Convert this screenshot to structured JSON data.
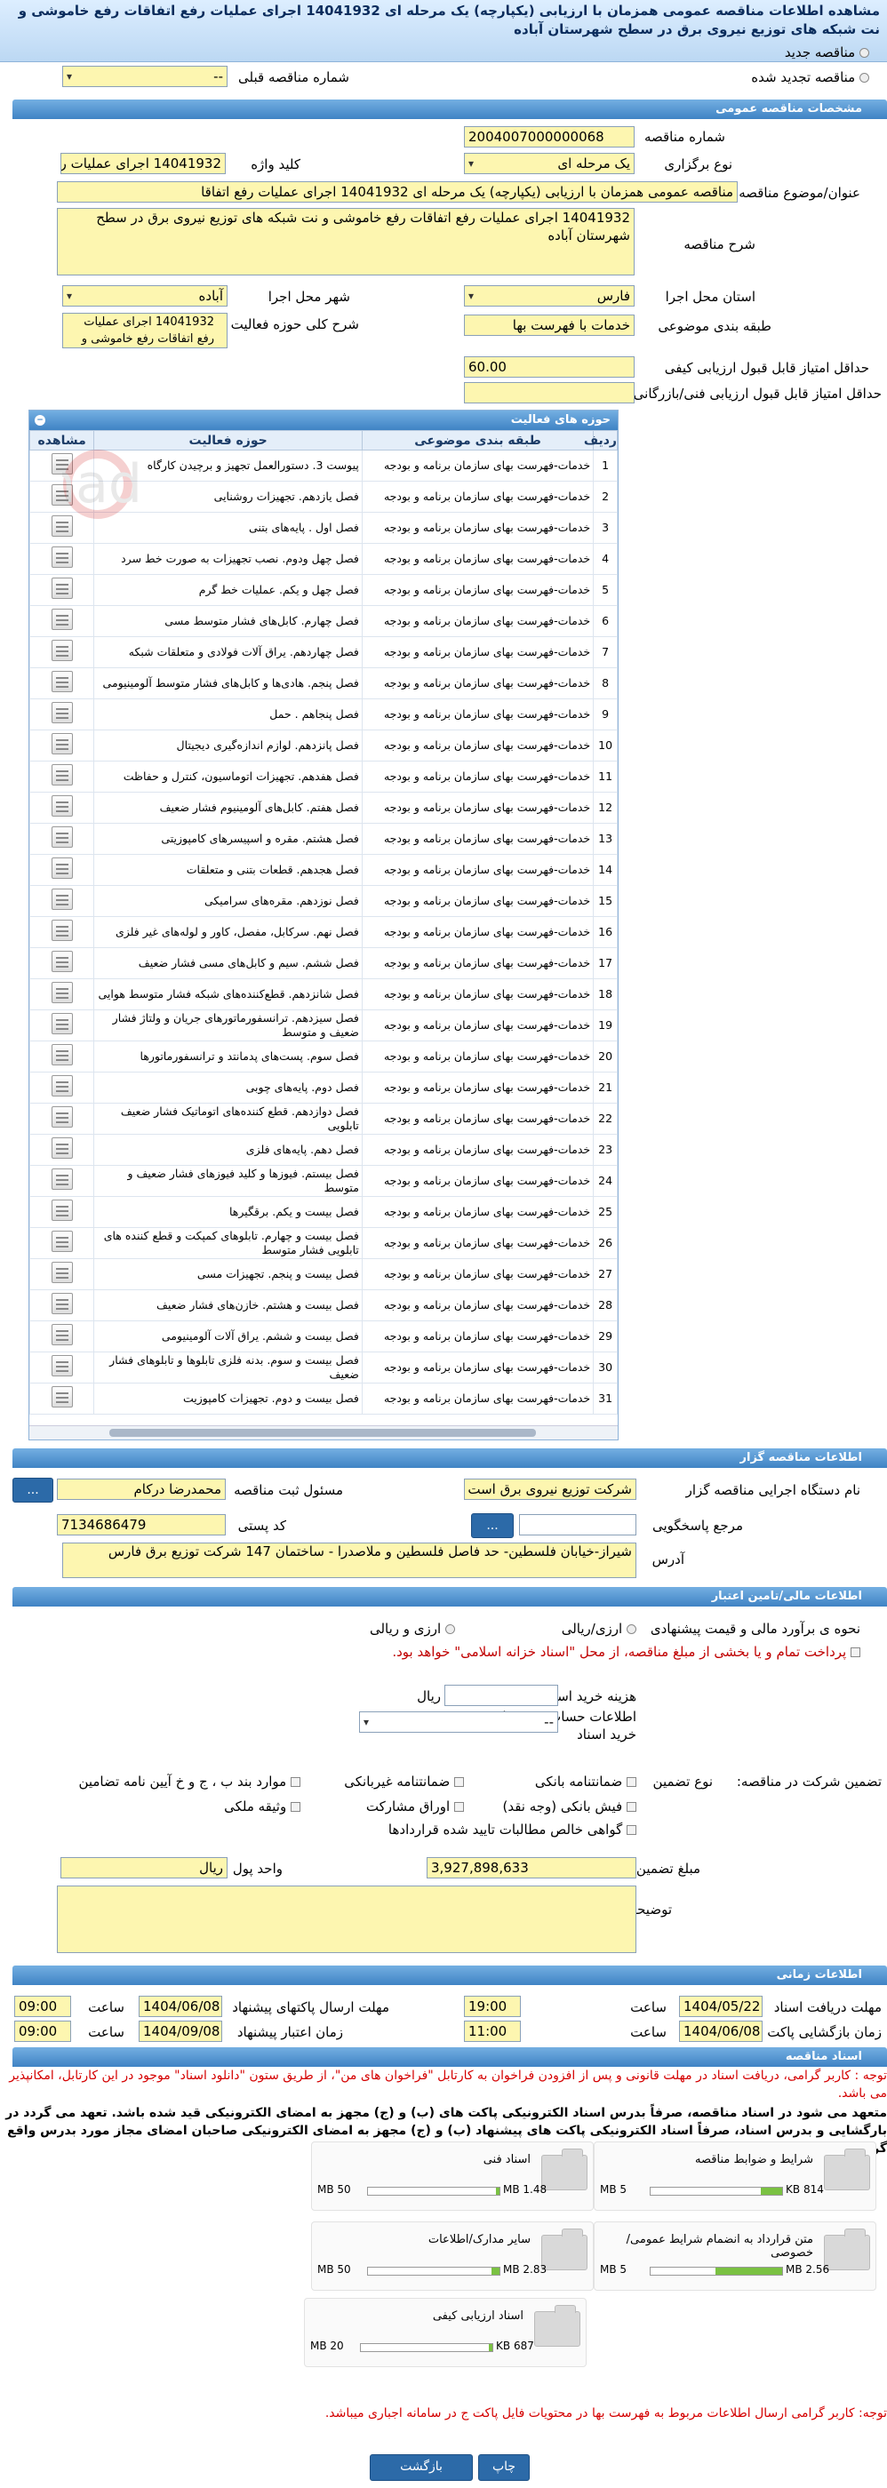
{
  "page_title": "مشاهده اطلاعات مناقصه عمومی همزمان با ارزیابی (یکپارچه) یک مرحله ای 14041932 اجرای عملیات رفع اتفاقات رفع خاموشی و نت شبکه های توزیع نیروی برق در سطح شهرستان آباده",
  "tender_type": {
    "new": "مناقصه جدید",
    "renewed": "مناقصه تجدید شده",
    "prev_label": "شماره مناقصه قبلی",
    "prev_value": "--"
  },
  "sections": {
    "general": "مشخصات مناقصه عمومی",
    "organizer": "اطلاعات مناقصه گزار",
    "financial": "اطلاعات مالی/تامین اعتبار",
    "timing": "اطلاعات زمانی",
    "docs": "اسناد مناقصه"
  },
  "general": {
    "number_label": "شماره مناقصه",
    "number": "2004007000000068",
    "method_label": "نوع برگزاری",
    "method": "یک مرحله ای",
    "keyword_label": "کلید واژه",
    "keyword": "14041932 اجرای عملیات رف",
    "title_label": "عنوان/موضوع مناقصه",
    "title": "مناقصه عمومی همزمان با ارزیابی (یکپارچه) یک مرحله ای 14041932 اجرای عملیات رفع اتفاقا",
    "desc_label": "شرح مناقصه",
    "desc": "14041932 اجرای عملیات رفع اتفاقات رفع خاموشی و نت شبکه های توزیع نیروی برق در سطح شهرستان آباده",
    "province_label": "استان محل اجرا",
    "province": "فارس",
    "city_label": "شهر محل اجرا",
    "city": "آباده",
    "category_label": "طبقه بندی موضوعی",
    "category": "خدمات با فهرست بها",
    "scope_label": "شرح کلی حوزه فعالیت",
    "scope": "14041932 اجرای عملیات رفع اتفاقات رفع خاموشی و",
    "min_quality_label": "حداقل امتیاز قابل قبول ارزیابی کیفی",
    "min_quality": "60.00",
    "min_tech_label": "حداقل امتیاز قابل قبول ارزیابی فنی/بازرگانی",
    "min_tech": ""
  },
  "activity_grid": {
    "caption": "حوزه های فعالیت",
    "headers": [
      "ردیف",
      "طبقه بندی موضوعی",
      "حوزه فعالیت",
      "مشاهده"
    ],
    "category_text": "خدمات-فهرست بهای سازمان برنامه و بودجه",
    "rows": [
      [
        "1",
        "پیوست 3. دستورالعمل تجهیز و برچیدن کارگاه"
      ],
      [
        "2",
        "فصل یازدهم. تجهیزات روشنایی"
      ],
      [
        "3",
        "فصل اول . پایه‌های بتنی"
      ],
      [
        "4",
        "فصل چهل ودوم. نصب تجهیزات به صورت خط سرد"
      ],
      [
        "5",
        "فصل چهل و یکم. عملیات خط گرم"
      ],
      [
        "6",
        "فصل چهارم. کابل‌های فشار متوسط مسی"
      ],
      [
        "7",
        "فصل چهاردهم. یراق آلات فولادی و متعلقات شبکه"
      ],
      [
        "8",
        "فصل پنجم. هادی‌ها و کابل‌های فشار متوسط آلومینیومی"
      ],
      [
        "9",
        "فصل پنجاهم . حمل"
      ],
      [
        "10",
        "فصل پانزدهم. لوازم اندازه‌گیری دیجیتال"
      ],
      [
        "11",
        "فصل هفدهم. تجهیزات اتوماسیون، کنترل و حفاظت"
      ],
      [
        "12",
        "فصل هفتم. کابل‌های آلومینیوم فشار ضعیف"
      ],
      [
        "13",
        "فصل هشتم. مقره و اسپیسرهای کامپوزیتی"
      ],
      [
        "14",
        "فصل هجدهم. قطعات بتنی و متعلقات"
      ],
      [
        "15",
        "فصل نوزدهم. مقره‌های سرامیکی"
      ],
      [
        "16",
        "فصل نهم. سرکابل، مفصل، کاور و لوله‌های غیر فلزی"
      ],
      [
        "17",
        "فصل ششم. سیم و کابل‌های مسی فشار ضعیف"
      ],
      [
        "18",
        "فصل شانزدهم. قطع‌کننده‌های شبکه فشار متوسط هوایی"
      ],
      [
        "19",
        "فصل سیزدهم. ترانسفورماتورهای جریان و ولتاژ فشار ضعیف و متوسط"
      ],
      [
        "20",
        "فصل سوم. پست‌های پدمانتد و ترانسفورماتورها"
      ],
      [
        "21",
        "فصل دوم. پایه‌های چوبی"
      ],
      [
        "22",
        "فصل دوازدهم. قطع کننده‌های اتوماتیک فشار ضعیف تابلویی"
      ],
      [
        "23",
        "فصل دهم. پایه‌های فلزی"
      ],
      [
        "24",
        "فصل بیستم. فیوزها و کلید فیوزهای فشار ضعیف و متوسط"
      ],
      [
        "25",
        "فصل بیست و یکم. برقگیرها"
      ],
      [
        "26",
        "فصل بیست و چهارم. تابلوهای کمپکت و قطع کننده های تابلویی فشار متوسط"
      ],
      [
        "27",
        "فصل بیست و پنجم. تجهیزات مسی"
      ],
      [
        "28",
        "فصل بیست و هشتم. خازن‌های فشار ضعیف"
      ],
      [
        "29",
        "فصل بیست و ششم. یراق آلات آلومینیومی"
      ],
      [
        "30",
        "فصل بیست و سوم. بدنه فلزی تابلوها و تابلوهای فشار ضعیف"
      ],
      [
        "31",
        "فصل بیست و دوم. تجهیزات کامپوزیت"
      ]
    ]
  },
  "organizer": {
    "org_label": "نام دستگاه اجرایی مناقصه گزار",
    "org": "شرکت توزیع نیروی برق است",
    "responsible_label": "مسئول ثبت مناقصه",
    "responsible": "محمدرضا درکام",
    "ref_label": "مرجع پاسخگویی",
    "ref": "",
    "postal_label": "کد پستی",
    "postal": "7134686479",
    "address_label": "آدرس",
    "address": "شیراز-خیابان فلسطین-  حد فاصل فلسطین و ملاصدرا - ساختمان 147 شرکت توزیع برق فارس",
    "more_btn": "...",
    "ref_btn": "..."
  },
  "financial": {
    "estimate_label": "نحوه ی برآورد مالی و قیمت پیشنهادی",
    "opt1": "ارزی/ریالی",
    "opt2": "ارزی و ریالی",
    "payment_note": "پرداخت تمام و یا بخشی از مبلغ مناقصه، از محل \"اسناد خزانه اسلامی\" خواهد بود.",
    "doc_fee_label": "هزینه خرید اسناد",
    "doc_fee": "",
    "rial": "ریال",
    "account_label": "اطلاعات حساب جهت واریز هزینه خرید اسناد",
    "account": "--",
    "guarantee_label": "تضمین شرکت در مناقصه:",
    "guarantee_type_label": "نوع تضمین",
    "g1": "ضمانتنامه بانکی",
    "g2": "ضمانتنامه غیربانکی",
    "g3": "موارد بند ب ، ج و خ آیین نامه تضامین",
    "g4": "فیش بانکی (وجه نقد)",
    "g5": "اوراق مشارکت",
    "g6": "وثیقه ملکی",
    "g7": "گواهی خالص مطالبات تایید شده قراردادها",
    "amount_label": "مبلغ تضمین",
    "amount": "3,927,898,633",
    "currency_label": "واحد پول",
    "currency": "ریال",
    "notes_label": "توضیحات",
    "notes": ""
  },
  "timing": {
    "receive_label": "مهلت دریافت اسناد",
    "receive_date": "1404/05/22",
    "receive_time": "19:00",
    "send_label": "مهلت ارسال پاکتهای پیشنهاد",
    "send_date": "1404/06/08",
    "send_time": "09:00",
    "open_label": "زمان بازگشایی پاکت ارزیابی کیفی",
    "open_date": "1404/06/08",
    "open_time": "11:00",
    "validity_label": "زمان اعتبار پیشنهاد",
    "validity_date": "1404/09/08",
    "validity_time": "09:00",
    "time_label": "ساعت"
  },
  "docs": {
    "notice1": "توجه : کاربر گرامی، دریافت اسناد در مهلت قانونی و پس از افزودن فراخوان به کارتابل \"فراخوان های من\"، از طریق ستون \"دانلود اسناد\" موجود در این کارتابل، امکانپذیر می باشد.",
    "notice2": "متعهد می شود در اسناد مناقصه، صرفاً بدرس اسناد الکترونیکی پاکت های (ب) و (ج) مجهز به امضای الکترونیکی قید شده باشد. تعهد می گردد در بارگشایی و بدرس اسناد، صرفاً اسناد الکترونیکی پاکت های پیشنهاد (ب) و (ج) مجهز به امضای الکترونیکی صاحبان امضای مجاز مورد بدرس واقع گردد.",
    "files": [
      {
        "name": "شرایط و ضوابط مناقصه",
        "size": "814 KB",
        "max": "5 MB",
        "fill": 0.16
      },
      {
        "name": "اسناد فنی",
        "size": "1.48 MB",
        "max": "50 MB",
        "fill": 0.03
      },
      {
        "name": "متن قرارداد به انضمام شرایط عمومی/خصوصی",
        "size": "2.56 MB",
        "max": "5 MB",
        "fill": 0.51
      },
      {
        "name": "سایر مدارک/اطلاعات",
        "size": "2.83 MB",
        "max": "50 MB",
        "fill": 0.06
      },
      {
        "name": "اسناد ارزیابی کیفی",
        "size": "687 KB",
        "max": "20 MB",
        "fill": 0.03
      }
    ],
    "notice3": "توجه: کاربر گرامی ارسال اطلاعات مربوط به فهرست بها در محتویات فایل پاکت ج در سامانه اجباری میباشد."
  },
  "buttons": {
    "print": "چاپ",
    "back": "بازگشت"
  },
  "watermark": "ParsNamadData"
}
